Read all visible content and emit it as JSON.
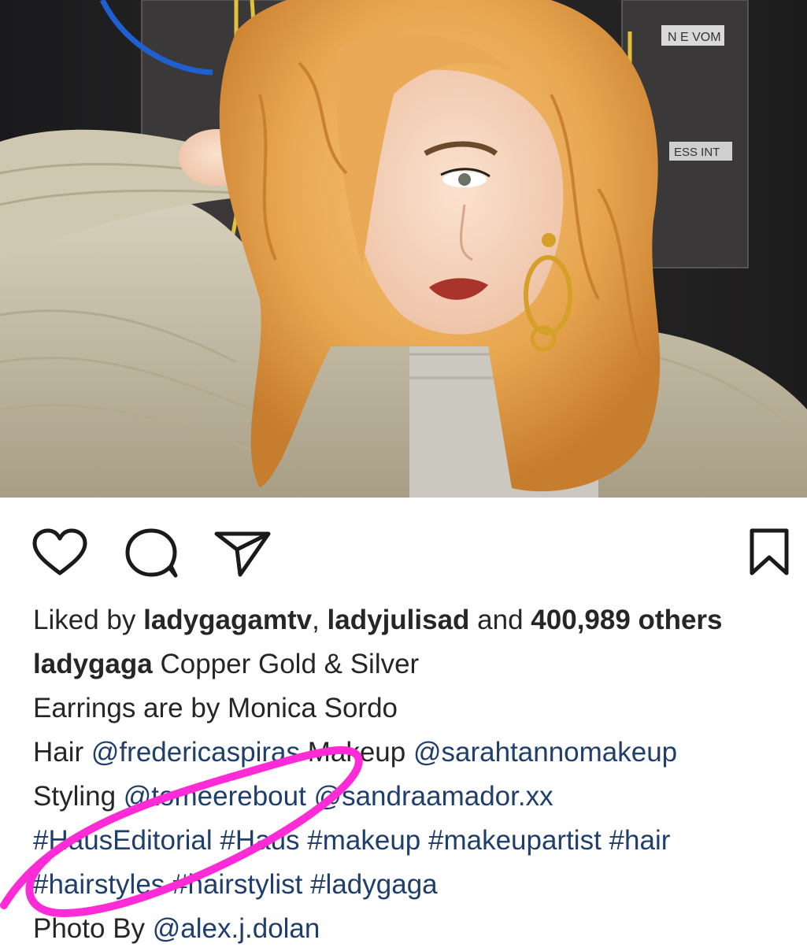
{
  "actions": {
    "like_icon": "heart-outline",
    "comment_icon": "speech-bubble-outline",
    "share_icon": "paper-plane-outline",
    "save_icon": "bookmark-outline"
  },
  "likes": {
    "prefix": "Liked by",
    "user1": "ladygagamtv",
    "separator": ", ",
    "user2": "ladyjulisad",
    "conjunction": " and ",
    "count": "400,989 others"
  },
  "caption": {
    "author": "ladygaga",
    "line1": " Copper Gold & Silver",
    "line2": "Earrings are by Monica Sordo",
    "hair_label": "Hair ",
    "hair_mention": "@fredericaspiras",
    "makeup_label": " Makeup ",
    "makeup_mention": "@sarahtannomakeup",
    "styling_label": "Styling ",
    "styling_mention1": "@tomeerebout",
    "styling_space": " ",
    "styling_mention2": "@sandraamador.xx",
    "hashtags_line1": [
      "#HausEditorial",
      "#Haus",
      "#makeup",
      "#makeupartist",
      "#hair"
    ],
    "hashtags_line2": [
      "#hairstyles",
      "#hairstylist",
      "#ladygaga"
    ],
    "photo_label": "Photo By ",
    "photo_mention": "@alex.j.dolan"
  },
  "colors": {
    "link": "#1f3e6b",
    "annotation": "#ff2bd6",
    "text": "#262626"
  }
}
